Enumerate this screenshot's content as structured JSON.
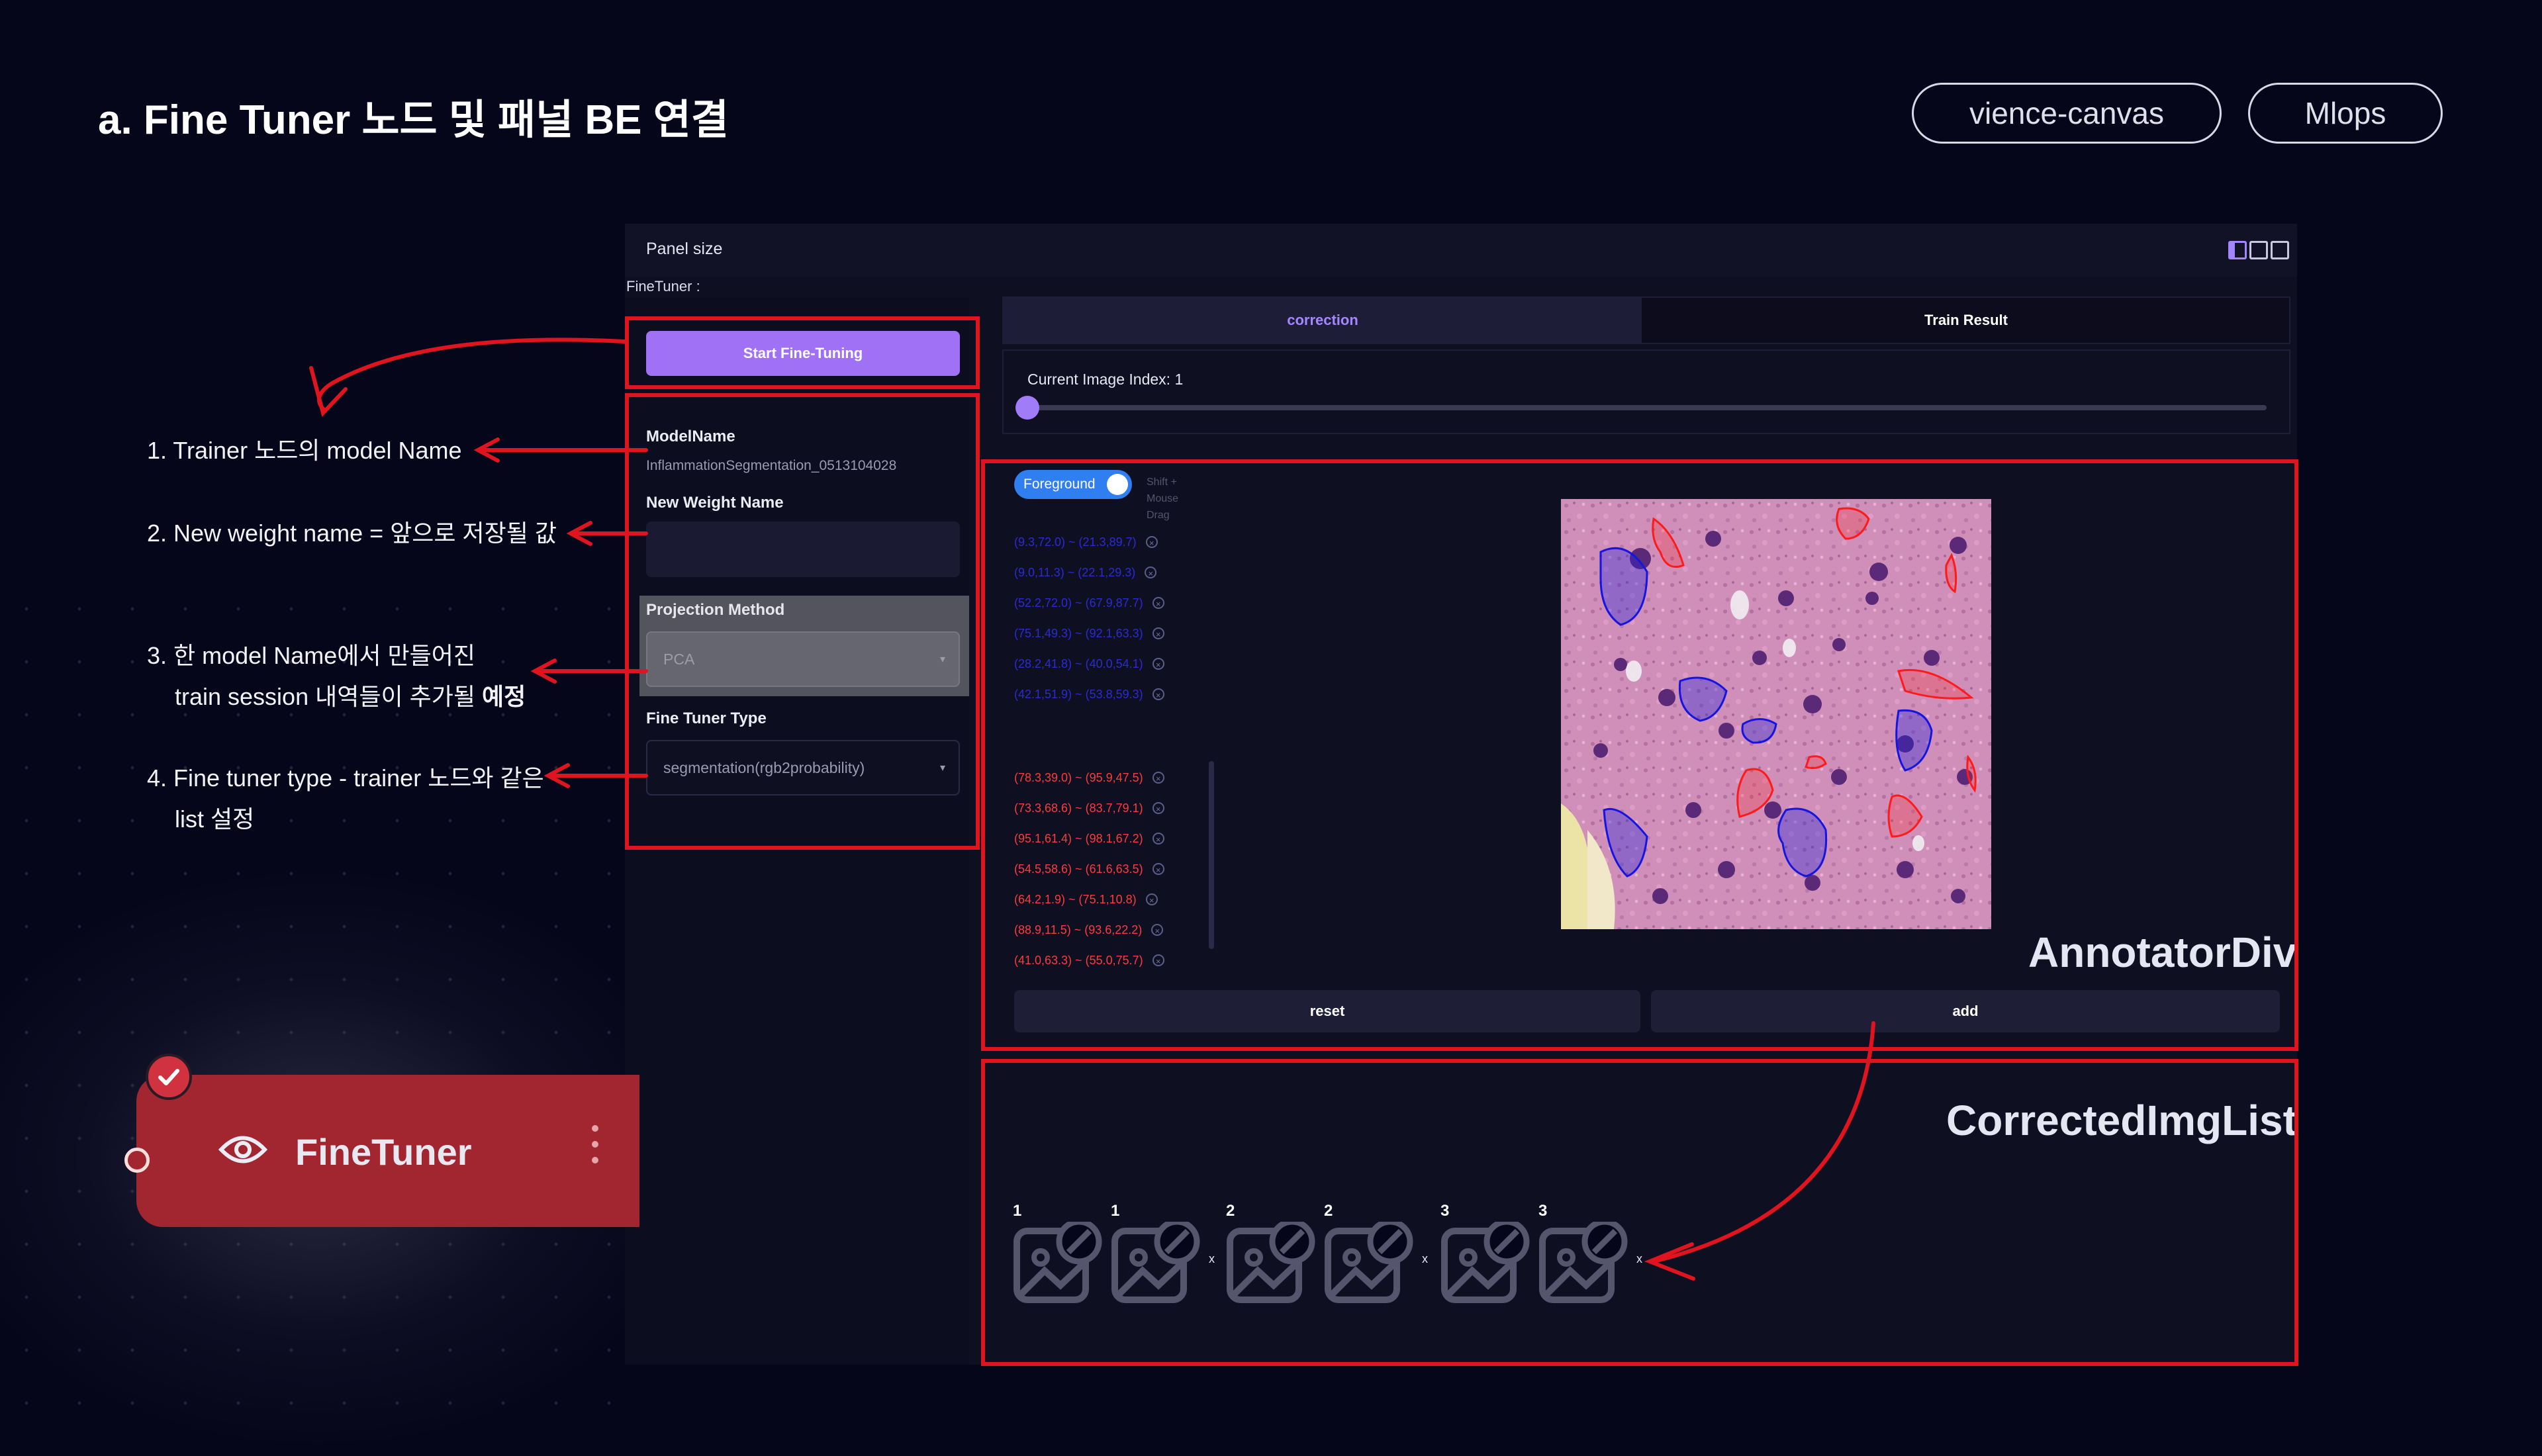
{
  "slide": {
    "title": "a. Fine Tuner 노드 및 패널 BE 연결",
    "tags": [
      "vience-canvas",
      "Mlops"
    ]
  },
  "annotations": [
    {
      "line1": "1. Trainer 노드의 model Name"
    },
    {
      "line1": "2. New weight name = 앞으로 저장될 값"
    },
    {
      "line1": "3. 한 model Name에서 만들어진",
      "line2_a": "train session 내역들이 추가될 ",
      "line2_b": "예정"
    },
    {
      "line1": "4. Fine tuner type - trainer 노드와 같은",
      "line2": "list 설정"
    }
  ],
  "panel": {
    "header": "Panel size",
    "finetuner_label": "FineTuner :",
    "start_button": "Start Fine-Tuning",
    "model_name_label": "ModelName",
    "model_name_value": "InflammationSegmentation_0513104028",
    "new_weight_label": "New Weight Name",
    "new_weight_value": "",
    "projection_label": "Projection Method",
    "projection_value": "PCA",
    "type_label": "Fine Tuner Type",
    "type_value": "segmentation(rgb2probability)"
  },
  "tabs": [
    "correction",
    "Train Result"
  ],
  "slider": {
    "label": "Current Image Index: 1",
    "value": 1
  },
  "annotator": {
    "toggle_label": "Foreground",
    "hint": "Shift + Mouse Drag",
    "blue_coords": [
      "(9.3,72.0) ~ (21.3,89.7)",
      "(9.0,11.3) ~ (22.1,29.3)",
      "(52.2,72.0) ~ (67.9,87.7)",
      "(75.1,49.3) ~ (92.1,63.3)",
      "(28.2,41.8) ~ (40.0,54.1)",
      "(42.1,51.9) ~ (53.8,59.3)"
    ],
    "red_coords": [
      "(78.3,39.0) ~ (95.9,47.5)",
      "(73.3,68.6) ~ (83.7,79.1)",
      "(95.1,61.4) ~ (98.1,67.2)",
      "(54.5,58.6) ~ (61.6,63.5)",
      "(64.2,1.9) ~ (75.1,10.8)",
      "(88.9,11.5) ~ (93.6,22.2)",
      "(41.0,63.3) ~ (55.0,75.7)"
    ],
    "reset_label": "reset",
    "add_label": "add",
    "div_label": "AnnotatorDiv"
  },
  "corrected": {
    "div_label": "CorrectedImgList",
    "items": [
      "1",
      "1",
      "2",
      "2",
      "3",
      "3"
    ],
    "remove_symbol": "x"
  },
  "node": {
    "name": "FineTuner"
  },
  "colors": {
    "accent": "#a070f5",
    "annotation_red": "#e0141e",
    "blue_mask": "#2020e0",
    "red_mask": "#ff1a1a"
  }
}
